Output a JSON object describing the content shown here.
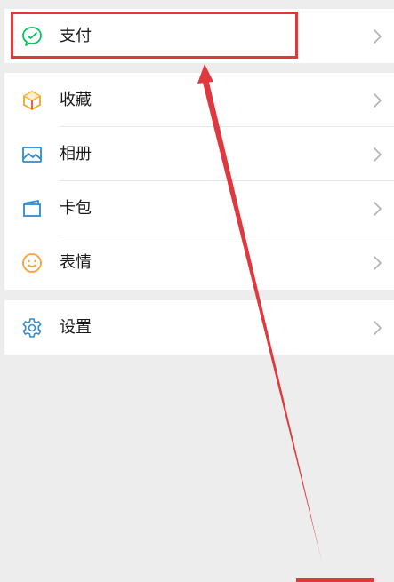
{
  "groups": [
    {
      "items": [
        {
          "key": "pay",
          "label": "支付",
          "icon": "wechat-pay-icon"
        }
      ]
    },
    {
      "items": [
        {
          "key": "favorites",
          "label": "收藏",
          "icon": "favorites-cube-icon"
        },
        {
          "key": "album",
          "label": "相册",
          "icon": "album-picture-icon"
        },
        {
          "key": "cards",
          "label": "卡包",
          "icon": "card-wallet-icon"
        },
        {
          "key": "stickers",
          "label": "表情",
          "icon": "smiley-icon"
        }
      ]
    },
    {
      "items": [
        {
          "key": "settings",
          "label": "设置",
          "icon": "gear-icon"
        }
      ]
    }
  ],
  "colors": {
    "background": "#ededed",
    "row_background": "#ffffff",
    "annotation_red": "#e0383f",
    "pay_green": "#07c160",
    "favorites_orange": "#f5a623",
    "blue_icon": "#2e8bd7",
    "smiley_orange": "#f0a43a",
    "chevron_gray": "#b2b2b2"
  },
  "annotation": {
    "type": "red-highlight-box-with-arrow",
    "target": "pay"
  }
}
